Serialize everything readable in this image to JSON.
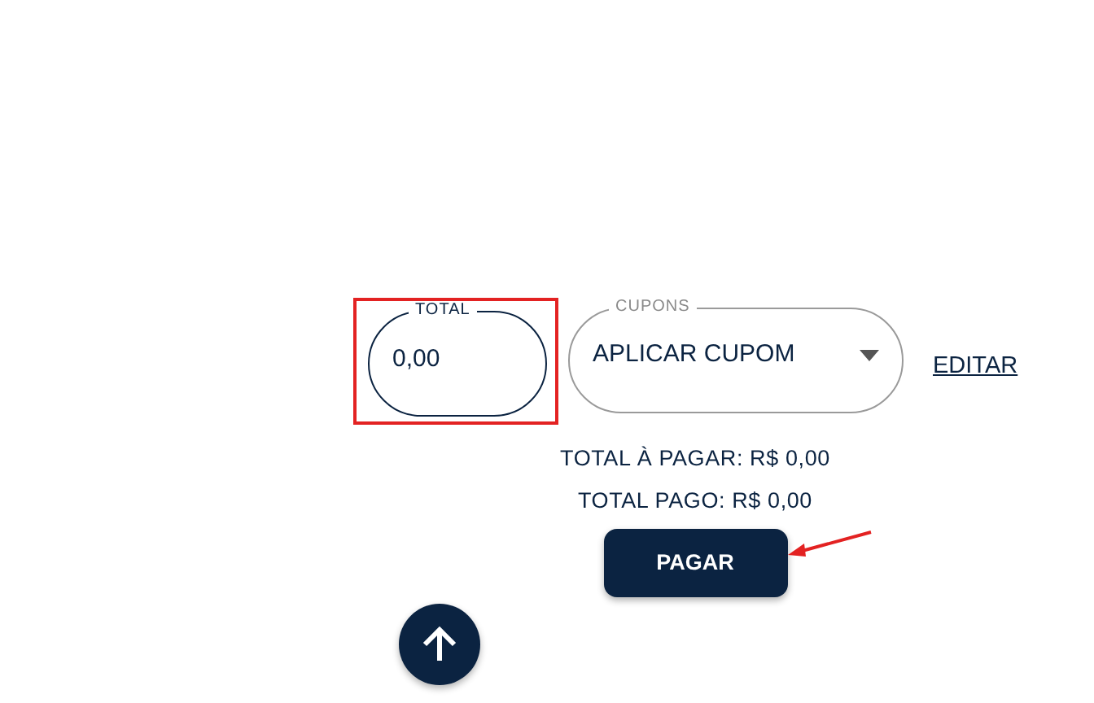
{
  "total_field": {
    "label": "TOTAL",
    "value": "0,00"
  },
  "coupons_select": {
    "label": "CUPONS",
    "value": "APLICAR CUPOM"
  },
  "edit_link": "EDITAR",
  "summary": [
    "TOTAL À PAGAR: R$ 0,00",
    "TOTAL PAGO: R$ 0,00"
  ],
  "pay_button": "PAGAR"
}
